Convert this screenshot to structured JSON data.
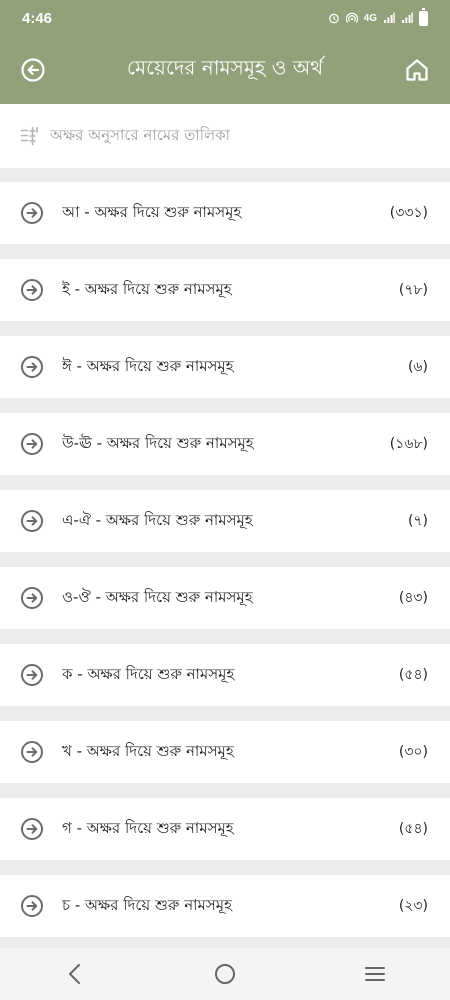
{
  "status_bar": {
    "time": "4:46",
    "network": "4G",
    "icons": [
      "alarm-icon",
      "hotspot-icon",
      "signal-icon",
      "signal-icon",
      "battery-icon"
    ]
  },
  "app_bar": {
    "title": "মেয়েদের নামসমূহ ও অর্থ",
    "back_icon": "back-circle-icon",
    "home_icon": "home-icon",
    "background": "#93a17b"
  },
  "section": {
    "icon": "sort-icon",
    "label": "অক্ষর অনুসারে নামের তালিকা"
  },
  "list": {
    "arrow_icon": "arrow-right-circle-icon",
    "items": [
      {
        "label": "আ - অক্ষর দিয়ে শুরু নামসমূহ",
        "count": "(৩৩১)"
      },
      {
        "label": "ই - অক্ষর দিয়ে শুরু নামসমূহ",
        "count": "(৭৮)"
      },
      {
        "label": "ঈ - অক্ষর দিয়ে শুরু নামসমূহ",
        "count": "(৬)"
      },
      {
        "label": "উ-ঊ - অক্ষর দিয়ে শুরু নামসমূহ",
        "count": "(১৬৮)"
      },
      {
        "label": "এ-ঐ - অক্ষর দিয়ে শুরু নামসমূহ",
        "count": "(৭)"
      },
      {
        "label": "ও-ঔ - অক্ষর দিয়ে শুরু নামসমূহ",
        "count": "(৪৩)"
      },
      {
        "label": "ক - অক্ষর দিয়ে শুরু নামসমূহ",
        "count": "(৫৪)"
      },
      {
        "label": "খ - অক্ষর দিয়ে শুরু নামসমূহ",
        "count": "(৩০)"
      },
      {
        "label": "গ - অক্ষর দিয়ে শুরু নামসমূহ",
        "count": "(৫৪)"
      },
      {
        "label": "চ - অক্ষর দিয়ে শুরু নামসমূহ",
        "count": "(২৩)"
      }
    ]
  },
  "nav_bar": {
    "icons": [
      "back-chevron-icon",
      "home-circle-icon",
      "recents-menu-icon"
    ]
  }
}
